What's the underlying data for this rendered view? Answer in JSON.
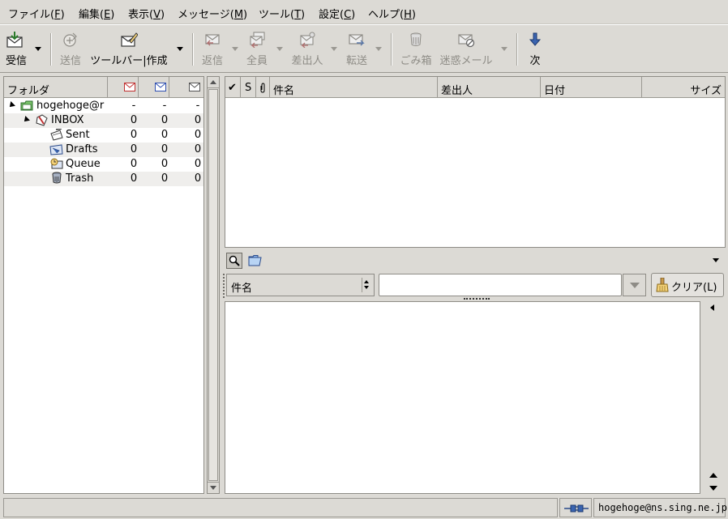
{
  "menubar": {
    "items": [
      "ファイル(F)",
      "編集(E)",
      "表示(V)",
      "メッセージ(M)",
      "ツール(T)",
      "設定(C)",
      "ヘルプ(H)"
    ],
    "underline": [
      "F",
      "E",
      "V",
      "M",
      "T",
      "C",
      "H"
    ]
  },
  "toolbar": {
    "receive": "受信",
    "send": "送信",
    "compose": "ツールバー|作成",
    "reply": "返信",
    "reply_all": "全員",
    "reply_sender": "差出人",
    "forward": "転送",
    "trash": "ごみ箱",
    "junk": "迷惑メール",
    "next": "次"
  },
  "folder_pane": {
    "header": "フォルダ",
    "rows": [
      {
        "name": "hogehoge@r",
        "new": "-",
        "unread": "-",
        "total": "-",
        "icon": "mailbox-icon"
      },
      {
        "name": "INBOX",
        "new": "0",
        "unread": "0",
        "total": "0",
        "icon": "inbox-icon"
      },
      {
        "name": "Sent",
        "new": "0",
        "unread": "0",
        "total": "0",
        "icon": "sent-icon"
      },
      {
        "name": "Drafts",
        "new": "0",
        "unread": "0",
        "total": "0",
        "icon": "drafts-icon"
      },
      {
        "name": "Queue",
        "new": "0",
        "unread": "0",
        "total": "0",
        "icon": "queue-icon"
      },
      {
        "name": "Trash",
        "new": "0",
        "unread": "0",
        "total": "0",
        "icon": "trash-icon"
      }
    ]
  },
  "summary": {
    "columns": {
      "mark": "✔",
      "status": "S",
      "attach": "𝟎",
      "subject": "件名",
      "from": "差出人",
      "date": "日付",
      "size": "サイズ"
    }
  },
  "quicksearch": {
    "field": "件名",
    "value": "",
    "clear": "クリア(L)"
  },
  "status": {
    "account": "hogehoge@ns.sing.ne.jp"
  },
  "colors": {
    "window_bg": "#dcdad5",
    "pane_bg": "#ffffff",
    "border": "#8e8c86",
    "disabled_text": "#8e8c86"
  }
}
